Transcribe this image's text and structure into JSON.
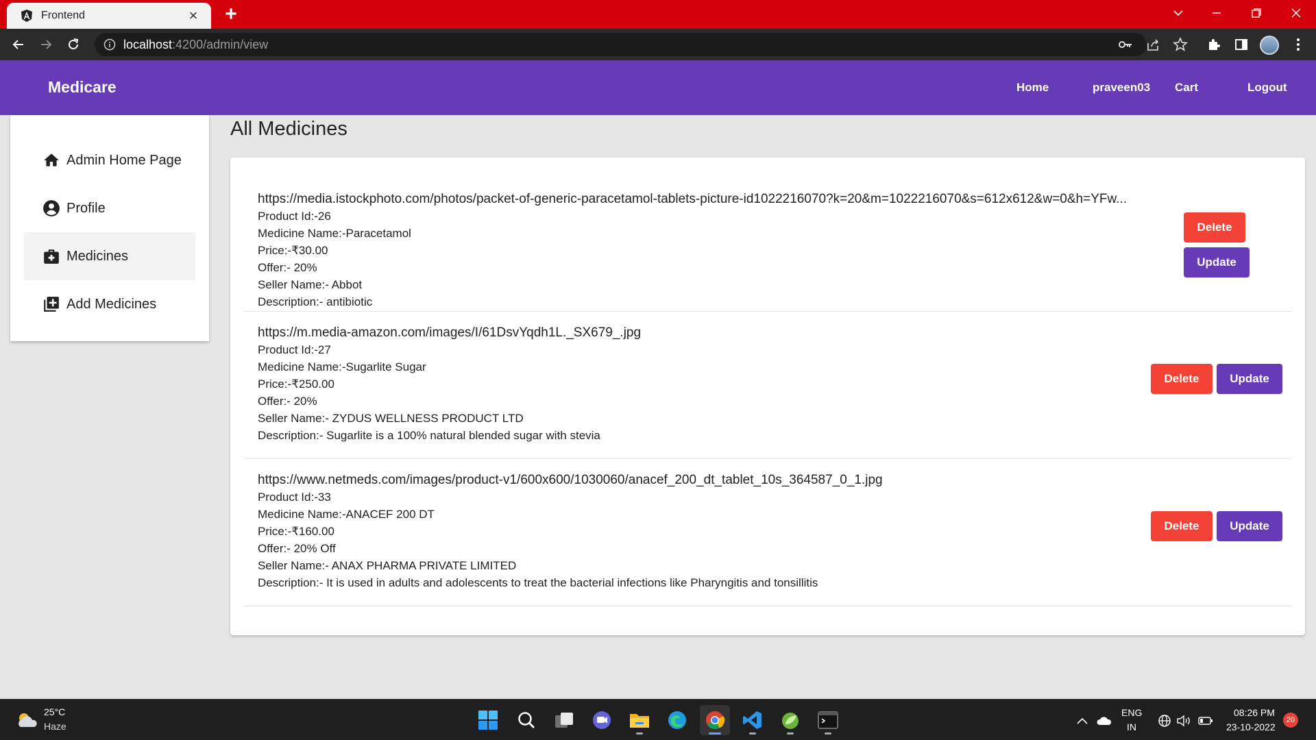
{
  "browser": {
    "tab_title": "Frontend",
    "url_host": "localhost",
    "url_rest": ":4200/admin/view",
    "accent": "#d4000c"
  },
  "app": {
    "brand": "Medicare",
    "nav": {
      "home": "Home",
      "user": "praveen03",
      "cart": "Cart",
      "logout": "Logout"
    },
    "primary_color": "#673ab7",
    "danger_color": "#f44336"
  },
  "sidebar": {
    "items": [
      {
        "label": "Admin Home Page",
        "icon": "home-icon"
      },
      {
        "label": "Profile",
        "icon": "account-circle-icon"
      },
      {
        "label": "Medicines",
        "icon": "medical-bag-icon",
        "active": true
      },
      {
        "label": "Add Medicines",
        "icon": "library-add-icon"
      }
    ]
  },
  "main": {
    "title": "All Medicines",
    "delete_label": "Delete",
    "update_label": "Update",
    "medicines": [
      {
        "url": "https://media.istockphoto.com/photos/packet-of-generic-paracetamol-tablets-picture-id1022216070?k=20&m=1022216070&s=612x612&w=0&h=YFw...",
        "product_id": "Product Id:-26",
        "name": "Medicine Name:-Paracetamol",
        "price": "Price:-₹30.00",
        "offer": "Offer:- 20%",
        "seller": "Seller Name:- Abbot",
        "description": "Description:- antibiotic"
      },
      {
        "url": "https://m.media-amazon.com/images/I/61DsvYqdh1L._SX679_.jpg",
        "product_id": "Product Id:-27",
        "name": "Medicine Name:-Sugarlite Sugar",
        "price": "Price:-₹250.00",
        "offer": "Offer:- 20%",
        "seller": "Seller Name:- ZYDUS WELLNESS PRODUCT LTD",
        "description": "Description:- Sugarlite is a 100% natural blended sugar with stevia"
      },
      {
        "url": "https://www.netmeds.com/images/product-v1/600x600/1030060/anacef_200_dt_tablet_10s_364587_0_1.jpg",
        "product_id": "Product Id:-33",
        "name": "Medicine Name:-ANACEF 200 DT",
        "price": "Price:-₹160.00",
        "offer": "Offer:- 20% Off",
        "seller": "Seller Name:- ANAX PHARMA PRIVATE LIMITED",
        "description": "Description:- It is used in adults and adolescents to treat the bacterial infections like Pharyngitis and tonsillitis"
      }
    ]
  },
  "taskbar": {
    "temp": "25°C",
    "condition": "Haze",
    "lang_top": "ENG",
    "lang_bottom": "IN",
    "time": "08:26 PM",
    "date": "23-10-2022",
    "notifications": "20"
  }
}
